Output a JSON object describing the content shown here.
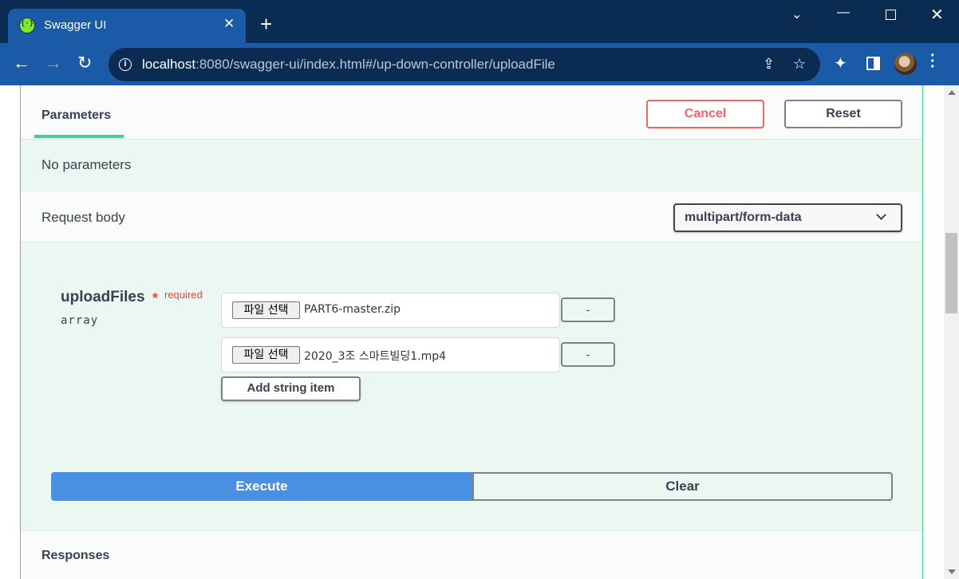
{
  "browser": {
    "tab_title": "Swagger UI",
    "tab_close": "✕",
    "new_tab": "+",
    "url_host": "localhost",
    "url_rest": ":8080/swagger-ui/index.html#/up-down-controller/uploadFile",
    "window_controls": {
      "chevron": "⌄",
      "minimize": "—",
      "close": "✕"
    },
    "nav": {
      "back": "←",
      "forward": "→",
      "reload": "↻"
    },
    "info": "i",
    "share": "⇪",
    "star": "☆",
    "extensions": "✦",
    "menu": "⋮"
  },
  "parameters_section": {
    "tab_label": "Parameters",
    "cancel_label": "Cancel",
    "reset_label": "Reset",
    "no_params_text": "No parameters"
  },
  "request_body": {
    "title": "Request body",
    "content_type": "multipart/form-data",
    "param": {
      "name": "uploadFiles",
      "required_star": "*",
      "required_label": "required",
      "type": "array"
    },
    "files": [
      {
        "button_label": "파일 선택",
        "file_name": "PART6-master.zip",
        "remove_label": "-"
      },
      {
        "button_label": "파일 선택",
        "file_name": "2020_3조 스마트빌딩1.mp4",
        "remove_label": "-"
      }
    ],
    "add_item_label": "Add string item"
  },
  "actions": {
    "execute_label": "Execute",
    "clear_label": "Clear"
  },
  "responses": {
    "title": "Responses"
  },
  "colors": {
    "accent_green": "#49cc90",
    "cancel_red": "#ff6060",
    "execute_blue": "#4990e2",
    "chrome_dark": "#0b2c52",
    "chrome_tab": "#1a5aa6"
  }
}
